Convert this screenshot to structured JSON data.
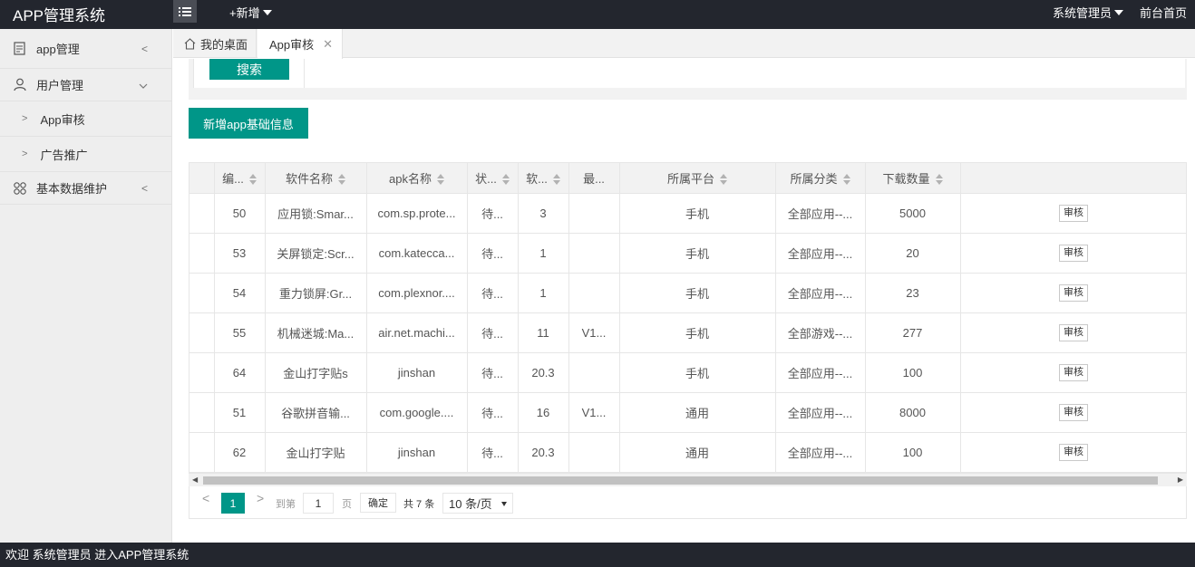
{
  "topbar": {
    "title": "APP管理系统",
    "new_label": "+新增",
    "admin_label": "系统管理员",
    "home_label": "前台首页"
  },
  "sidebar": {
    "items": [
      {
        "label": "app管理",
        "icon": "document-icon",
        "arrow": "<"
      },
      {
        "label": "用户管理",
        "icon": "user-icon",
        "arrow": "v"
      },
      {
        "label": "App审核",
        "icon": "chevron-right-icon"
      },
      {
        "label": "广告推广",
        "icon": "chevron-right-icon"
      },
      {
        "label": "基本数据维护",
        "icon": "grid-icon",
        "arrow": "<"
      }
    ]
  },
  "tabs": {
    "home": "我的桌面",
    "active": "App审核"
  },
  "search": {
    "button_label": "搜索"
  },
  "add_button_label": "新增app基础信息",
  "table": {
    "headers": [
      "编...",
      "软件名称",
      "apk名称",
      "状...",
      "软...",
      "最...",
      "所属平台",
      "所属分类",
      "下载数量"
    ],
    "rows": [
      {
        "id": "50",
        "name": "应用锁:Smar...",
        "apk": "com.sp.prote...",
        "status": "待...",
        "size": "3",
        "ver": "",
        "platform": "手机",
        "category": "全部应用--...",
        "downloads": "5000",
        "action": "审核"
      },
      {
        "id": "53",
        "name": "关屏锁定:Scr...",
        "apk": "com.katecca...",
        "status": "待...",
        "size": "1",
        "ver": "",
        "platform": "手机",
        "category": "全部应用--...",
        "downloads": "20",
        "action": "审核"
      },
      {
        "id": "54",
        "name": "重力锁屏:Gr...",
        "apk": "com.plexnor....",
        "status": "待...",
        "size": "1",
        "ver": "",
        "platform": "手机",
        "category": "全部应用--...",
        "downloads": "23",
        "action": "审核"
      },
      {
        "id": "55",
        "name": "机械迷城:Ma...",
        "apk": "air.net.machi...",
        "status": "待...",
        "size": "11",
        "ver": "V1...",
        "platform": "手机",
        "category": "全部游戏--...",
        "downloads": "277",
        "action": "审核"
      },
      {
        "id": "64",
        "name": "金山打字贴s",
        "apk": "jinshan",
        "status": "待...",
        "size": "20.3",
        "ver": "",
        "platform": "手机",
        "category": "全部应用--...",
        "downloads": "100",
        "action": "审核"
      },
      {
        "id": "51",
        "name": "谷歌拼音输...",
        "apk": "com.google....",
        "status": "待...",
        "size": "16",
        "ver": "V1...",
        "platform": "通用",
        "category": "全部应用--...",
        "downloads": "8000",
        "action": "审核"
      },
      {
        "id": "62",
        "name": "金山打字贴",
        "apk": "jinshan",
        "status": "待...",
        "size": "20.3",
        "ver": "",
        "platform": "通用",
        "category": "全部应用--...",
        "downloads": "100",
        "action": "审核"
      }
    ]
  },
  "pager": {
    "current": "1",
    "goto_label": "到第",
    "page_value": "1",
    "page_unit": "页",
    "confirm": "确定",
    "total": "共 7 条",
    "page_size": "10 条/页"
  },
  "footer": {
    "text": "欢迎 系统管理员 进入APP管理系统"
  },
  "colors": {
    "accent": "#009688",
    "topbar": "#23262e"
  }
}
